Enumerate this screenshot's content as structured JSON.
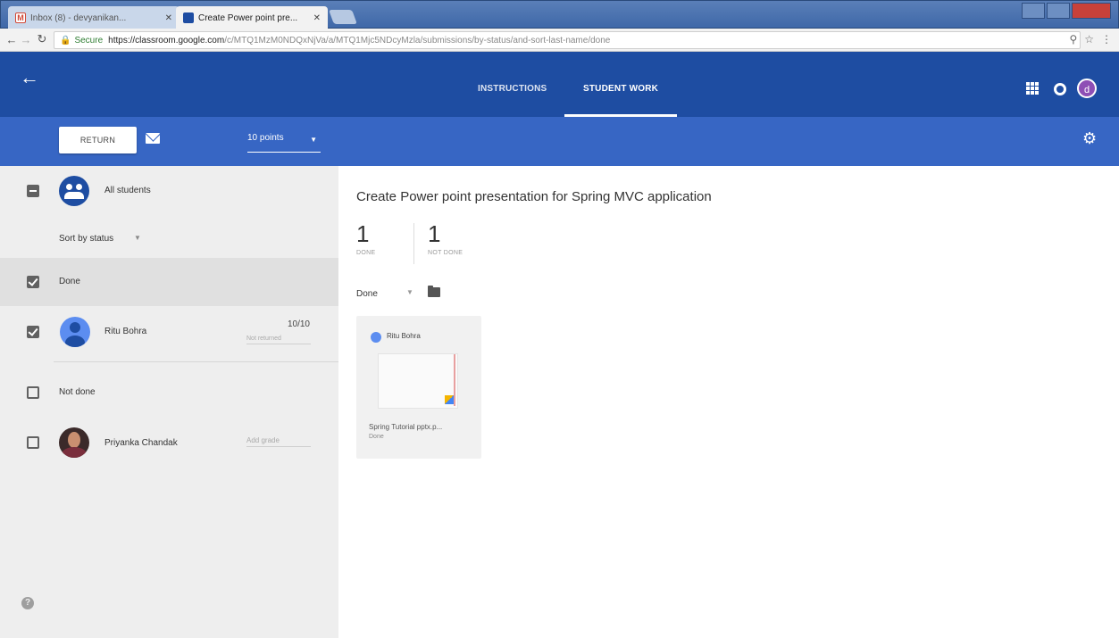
{
  "browser": {
    "tabs": [
      {
        "title": "Inbox (8) - devyanikan...",
        "active": false,
        "icon": "gmail-icon"
      },
      {
        "title": "Create Power point pre...",
        "active": true,
        "icon": "classroom-icon"
      }
    ],
    "secure_label": "Secure",
    "url_host": "https://classroom.google.com",
    "url_path": "/c/MTQ1MzM0NDQxNjVa/a/MTQ1Mjc5NDcyMzla/submissions/by-status/and-sort-last-name/done"
  },
  "header": {
    "tabs": [
      {
        "label": "INSTRUCTIONS",
        "active": false
      },
      {
        "label": "STUDENT WORK",
        "active": true
      }
    ],
    "user_initial": "d",
    "accent_color": "#1e4da2",
    "toolbar_color": "#3766c4"
  },
  "toolbar": {
    "return_label": "RETURN",
    "points_value": "10 points"
  },
  "sidebar": {
    "all_students_label": "All students",
    "sort_label": "Sort by status",
    "groups": [
      {
        "label": "Done",
        "students": [
          {
            "name": "Ritu Bohra",
            "grade": "10/10",
            "status": "Not returned"
          }
        ]
      },
      {
        "label": "Not done",
        "students": [
          {
            "name": "Priyanka Chandak",
            "grade_placeholder": "Add grade"
          }
        ]
      }
    ]
  },
  "main": {
    "title": "Create Power point presentation for Spring MVC application",
    "stats": [
      {
        "value": "1",
        "label": "DONE"
      },
      {
        "value": "1",
        "label": "NOT DONE"
      }
    ],
    "filter_label": "Done",
    "cards": [
      {
        "student": "Ritu Bohra",
        "file": "Spring Tutorial pptx.p...",
        "status": "Done"
      }
    ]
  }
}
